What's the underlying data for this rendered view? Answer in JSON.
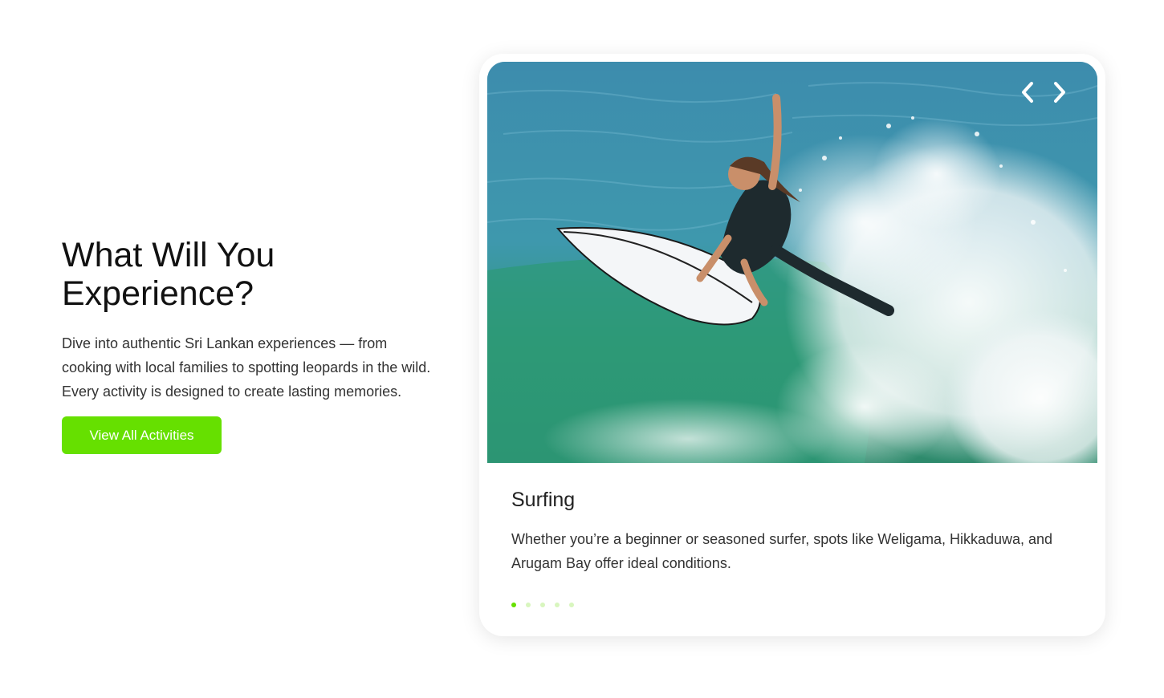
{
  "intro": {
    "title": "What Will You Experience?",
    "description": "Dive into authentic Sri Lankan experiences — from cooking with local families to spotting leopards in the wild. Every activity is designed to create lasting memories.",
    "cta_label": "View All Activities"
  },
  "carousel": {
    "prev_icon": "chevron-left-icon",
    "next_icon": "chevron-right-icon",
    "slide": {
      "title": "Surfing",
      "description": "Whether you’re a beginner or seasoned surfer, spots like Weligama, Hikkaduwa, and Arugam Bay offer ideal conditions.",
      "image": "surfer-riding-wave-photo"
    },
    "slide_count": 5,
    "active_index": 0
  },
  "colors": {
    "accent": "#66e000",
    "dot_inactive": "#d8f6be",
    "text": "#222222"
  }
}
